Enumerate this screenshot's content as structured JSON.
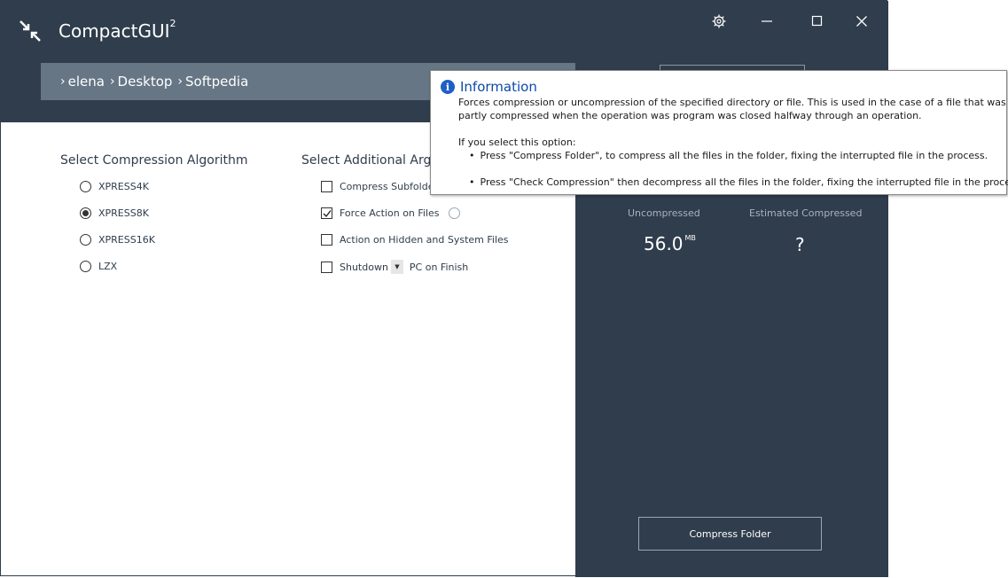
{
  "app": {
    "title": "CompactGUI",
    "title_superscript": "2"
  },
  "window_controls": {
    "settings_icon": "gear-icon",
    "minimize_icon": "minimize-icon",
    "maximize_icon": "maximize-icon",
    "close_icon": "close-icon"
  },
  "breadcrumb": {
    "items": [
      "elena",
      "Desktop",
      "Softpedia"
    ]
  },
  "algorithm": {
    "heading": "Select Compression Algorithm",
    "options": [
      "XPRESS4K",
      "XPRESS8K",
      "XPRESS16K",
      "LZX"
    ],
    "selected": "XPRESS8K"
  },
  "arguments": {
    "heading": "Select Additional Argu",
    "compress_subfolders": "Compress Subfolder",
    "force_action": "Force Action on Files",
    "hidden_system": "Action on Hidden and System Files",
    "shutdown": "Shutdown",
    "shutdown_suffix": "PC on Finish",
    "compress_subfolders_checked": false,
    "force_action_checked": true,
    "hidden_system_checked": false,
    "shutdown_checked": false
  },
  "stats": {
    "uncompressed_label": "Uncompressed",
    "uncompressed_value": "56.0",
    "uncompressed_unit": "MB",
    "estimated_label": "Estimated Compressed",
    "estimated_value": "?"
  },
  "actions": {
    "compress_folder": "Compress Folder"
  },
  "tooltip": {
    "title": "Information",
    "line1": "Forces compression or uncompression of the specified directory or file. This is used in the case of a file that was",
    "line2": "partly compressed when the operation was program was closed halfway through an operation.",
    "line3": "If you select this option:",
    "bullet1": "Press \"Compress Folder\", to compress all the files in the folder, fixing the interrupted file in the process.",
    "bullet2": "Press \"Check Compression\" then decompress all the files in the folder, fixing the interrupted file in the process."
  },
  "colors": {
    "header_bg": "#2f3d4c",
    "breadcrumb_bg": "#667685",
    "info_blue": "#1e5fc5"
  }
}
